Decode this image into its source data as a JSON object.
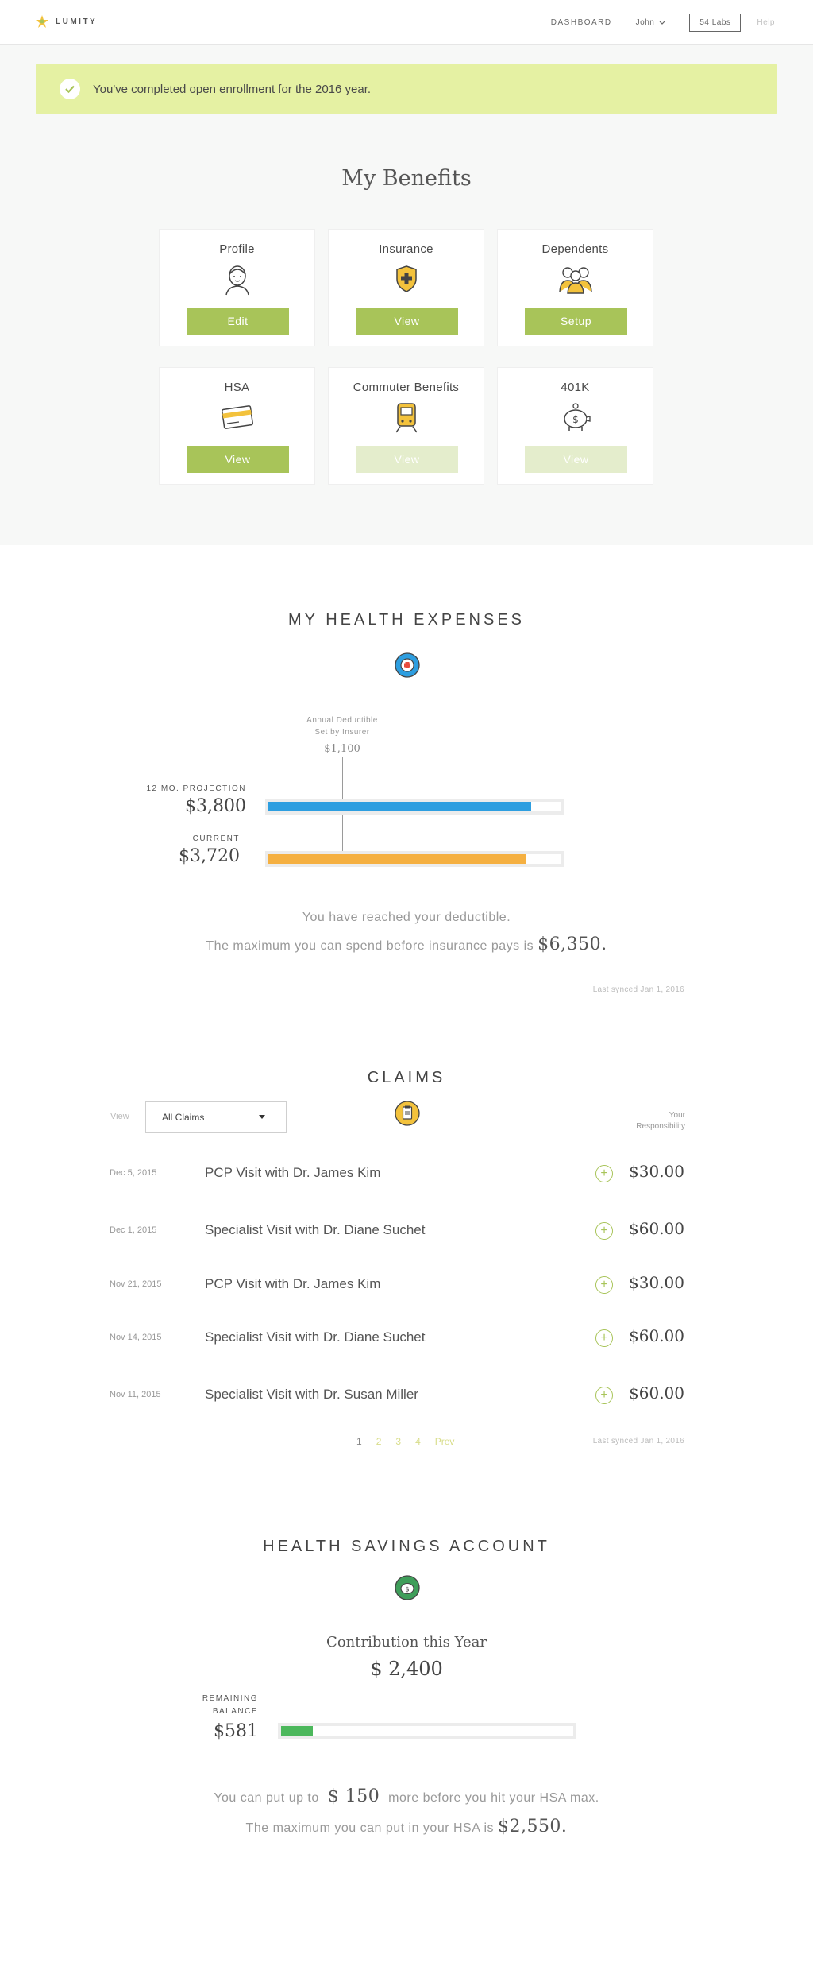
{
  "header": {
    "brand": "LUMITY",
    "nav_dashboard": "DASHBOARD",
    "nav_user": "John",
    "nav_company": "54 Labs",
    "nav_help": "Help"
  },
  "banner": {
    "message": "You've completed open enrollment for the 2016 year."
  },
  "benefits": {
    "title": "My Benefits",
    "cards": [
      {
        "title": "Profile",
        "button": "Edit",
        "icon": "profile-icon",
        "enabled": true
      },
      {
        "title": "Insurance",
        "button": "View",
        "icon": "shield-plus-icon",
        "enabled": true
      },
      {
        "title": "Dependents",
        "button": "Setup",
        "icon": "family-icon",
        "enabled": true
      },
      {
        "title": "HSA",
        "button": "View",
        "icon": "credit-card-icon",
        "enabled": true
      },
      {
        "title": "Commuter Benefits",
        "button": "View",
        "icon": "train-icon",
        "enabled": false
      },
      {
        "title": "401K",
        "button": "View",
        "icon": "piggy-bank-icon",
        "enabled": false
      }
    ]
  },
  "health_expenses": {
    "title": "MY HEALTH EXPENSES",
    "deductible_label_1": "Annual Deductible",
    "deductible_label_2": "Set by Insurer",
    "deductible_value": "$1,100",
    "projection_label": "12 MO. PROJECTION",
    "projection_value": "$3,800",
    "projection_fill": 0.9,
    "current_label": "CURRENT",
    "current_value": "$3,720",
    "current_fill": 0.88,
    "summary_prefix": "You have",
    "summary_status": "reached your deductible.",
    "max_text": "The maximum you can spend before insurance pays is",
    "max_value": "$6,350.",
    "synced": "Last synced Jan 1, 2016",
    "colors": {
      "projection": "#2d9ee0",
      "current": "#f5b041"
    }
  },
  "claims": {
    "title": "CLAIMS",
    "view_label": "View",
    "filter_value": "All Claims",
    "resp_label_1": "Your",
    "resp_label_2": "Responsibility",
    "rows": [
      {
        "date": "Dec 5, 2015",
        "desc": "PCP Visit with Dr. James Kim",
        "amount": "$30.00"
      },
      {
        "date": "Dec 1, 2015",
        "desc": "Specialist Visit with Dr. Diane Suchet",
        "amount": "$60.00"
      },
      {
        "date": "Nov 21, 2015",
        "desc": "PCP Visit with Dr. James Kim",
        "amount": "$30.00"
      },
      {
        "date": "Nov 14, 2015",
        "desc": "Specialist Visit with Dr. Diane Suchet",
        "amount": "$60.00"
      },
      {
        "date": "Nov 11, 2015",
        "desc": "Specialist Visit with Dr. Susan Miller",
        "amount": "$60.00"
      }
    ],
    "pages": [
      "1",
      "2",
      "3",
      "4",
      "Prev"
    ],
    "synced": "Last synced Jan 1, 2016"
  },
  "hsa": {
    "title": "HEALTH SAVINGS ACCOUNT",
    "contribution_label": "Contribution this Year",
    "contribution_value": "$ 2,400",
    "remaining_label_1": "REMAINING",
    "remaining_label_2": "BALANCE",
    "remaining_value": "$581",
    "remaining_fill": 0.11,
    "put_prefix": "You can put up to",
    "put_value": "$ 150",
    "put_suffix": "more before you hit your HSA max.",
    "max_text": "The maximum you can put in your HSA is",
    "max_value": "$2,550."
  }
}
